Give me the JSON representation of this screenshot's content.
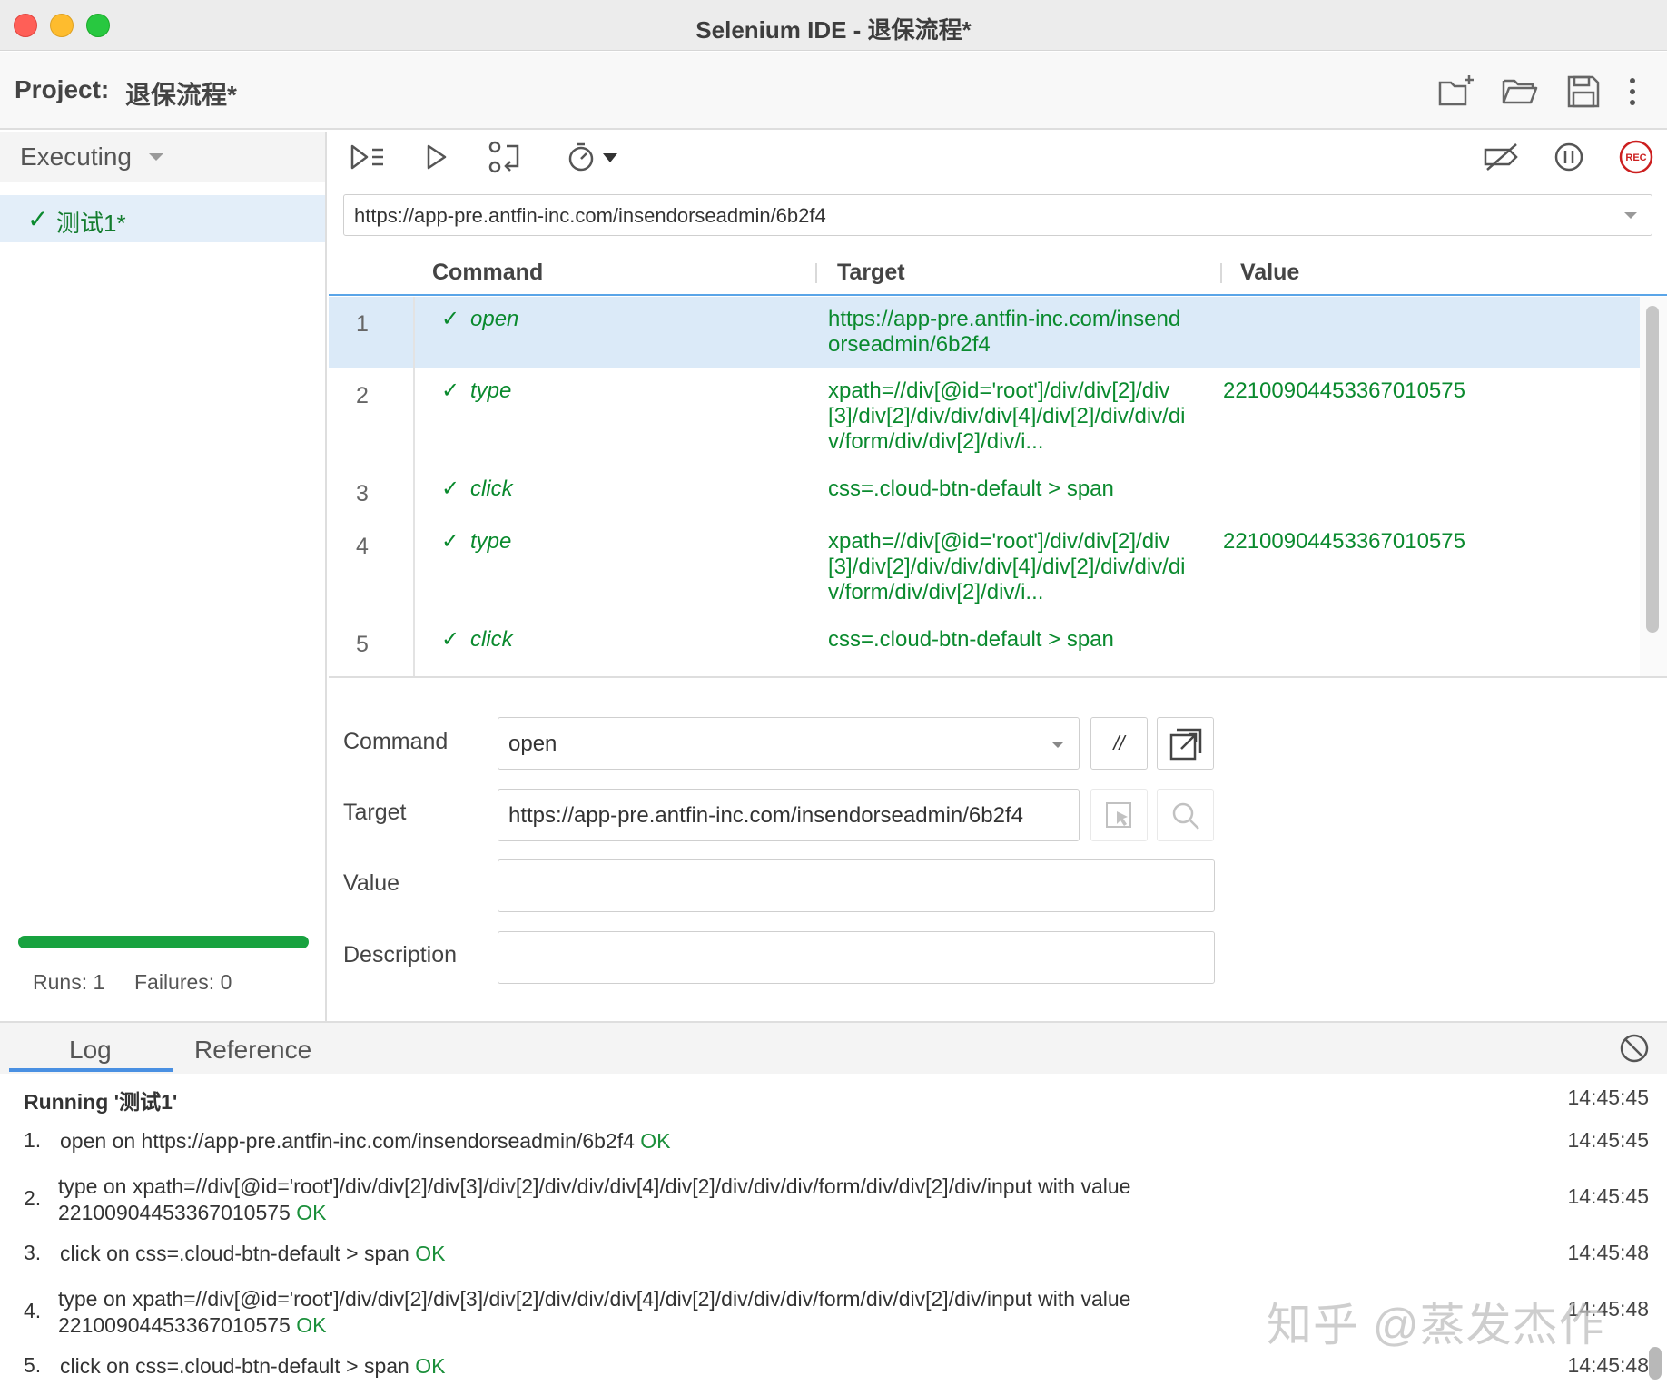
{
  "window": {
    "title": "Selenium IDE - 退保流程*"
  },
  "project": {
    "label": "Project:",
    "name": "退保流程*"
  },
  "header_icons": [
    "new-project-icon",
    "open-folder-icon",
    "save-icon",
    "more-vertical-icon"
  ],
  "sidebar": {
    "mode": "Executing",
    "tests": [
      {
        "name": "测试1*",
        "status": "passed"
      }
    ],
    "progress": 1.0,
    "runs": "Runs: 1",
    "failures": "Failures: 0"
  },
  "toolbar_icons": [
    "run-all-tests-icon",
    "run-current-test-icon",
    "step-over-icon",
    "test-speed-icon",
    "disable-breakpoints-icon",
    "pause-on-exceptions-icon",
    "record-icon"
  ],
  "record_label": "REC",
  "url": "https://app-pre.antfin-inc.com/insendorseadmin/6b2f4",
  "table": {
    "headers": {
      "command": "Command",
      "target": "Target",
      "value": "Value"
    },
    "rows": [
      {
        "num": "1",
        "command": "open",
        "target": "https://app-pre.antfin-inc.com/insendorseadmin/6b2f4",
        "value": ""
      },
      {
        "num": "2",
        "command": "type",
        "target": "xpath=//div[@id='root']/div/div[2]/div[3]/div[2]/div/div/div[4]/div[2]/div/div/div/form/div/div[2]/div/i...",
        "value": "22100904453367010575"
      },
      {
        "num": "3",
        "command": "click",
        "target": "css=.cloud-btn-default > span",
        "value": ""
      },
      {
        "num": "4",
        "command": "type",
        "target": "xpath=//div[@id='root']/div/div[2]/div[3]/div[2]/div/div/div[4]/div[2]/div/div/div/form/div/div[2]/div/i...",
        "value": "22100904453367010575"
      },
      {
        "num": "5",
        "command": "click",
        "target": "css=.cloud-btn-default > span",
        "value": ""
      }
    ]
  },
  "editor": {
    "command_label": "Command",
    "command_value": "open",
    "comment_button": "//",
    "target_label": "Target",
    "target_value": "https://app-pre.antfin-inc.com/insendorseadmin/6b2f4",
    "value_label": "Value",
    "value_value": "",
    "description_label": "Description",
    "description_value": ""
  },
  "bottom": {
    "tabs": [
      "Log",
      "Reference"
    ],
    "log_title": "Running '测试1'",
    "log_title_time": "14:45:45",
    "entries": [
      {
        "num": "1.",
        "text": "open on https://app-pre.antfin-inc.com/insendorseadmin/6b2f4",
        "status": "OK",
        "time": "14:45:45"
      },
      {
        "num": "2.",
        "text": "type on xpath=//div[@id='root']/div/div[2]/div[3]/div[2]/div/div/div[4]/div[2]/div/div/div/form/div/div[2]/div/input with value 22100904453367010575",
        "status": "OK",
        "time": "14:45:45"
      },
      {
        "num": "3.",
        "text": "click on css=.cloud-btn-default > span",
        "status": "OK",
        "time": "14:45:48"
      },
      {
        "num": "4.",
        "text": "type on xpath=//div[@id='root']/div/div[2]/div[3]/div[2]/div/div/div[4]/div[2]/div/div/div/form/div/div[2]/div/input with value 22100904453367010575",
        "status": "OK",
        "time": "14:45:48"
      },
      {
        "num": "5.",
        "text": "click on css=.cloud-btn-default > span",
        "status": "OK",
        "time": "14:45:48"
      }
    ],
    "watermark": "知乎 @蒸发杰作"
  },
  "colors": {
    "pass": "#0a8a2e",
    "accent": "#4a90e2",
    "selected_row": "#dbeaf8",
    "record": "#cc1f1f"
  }
}
